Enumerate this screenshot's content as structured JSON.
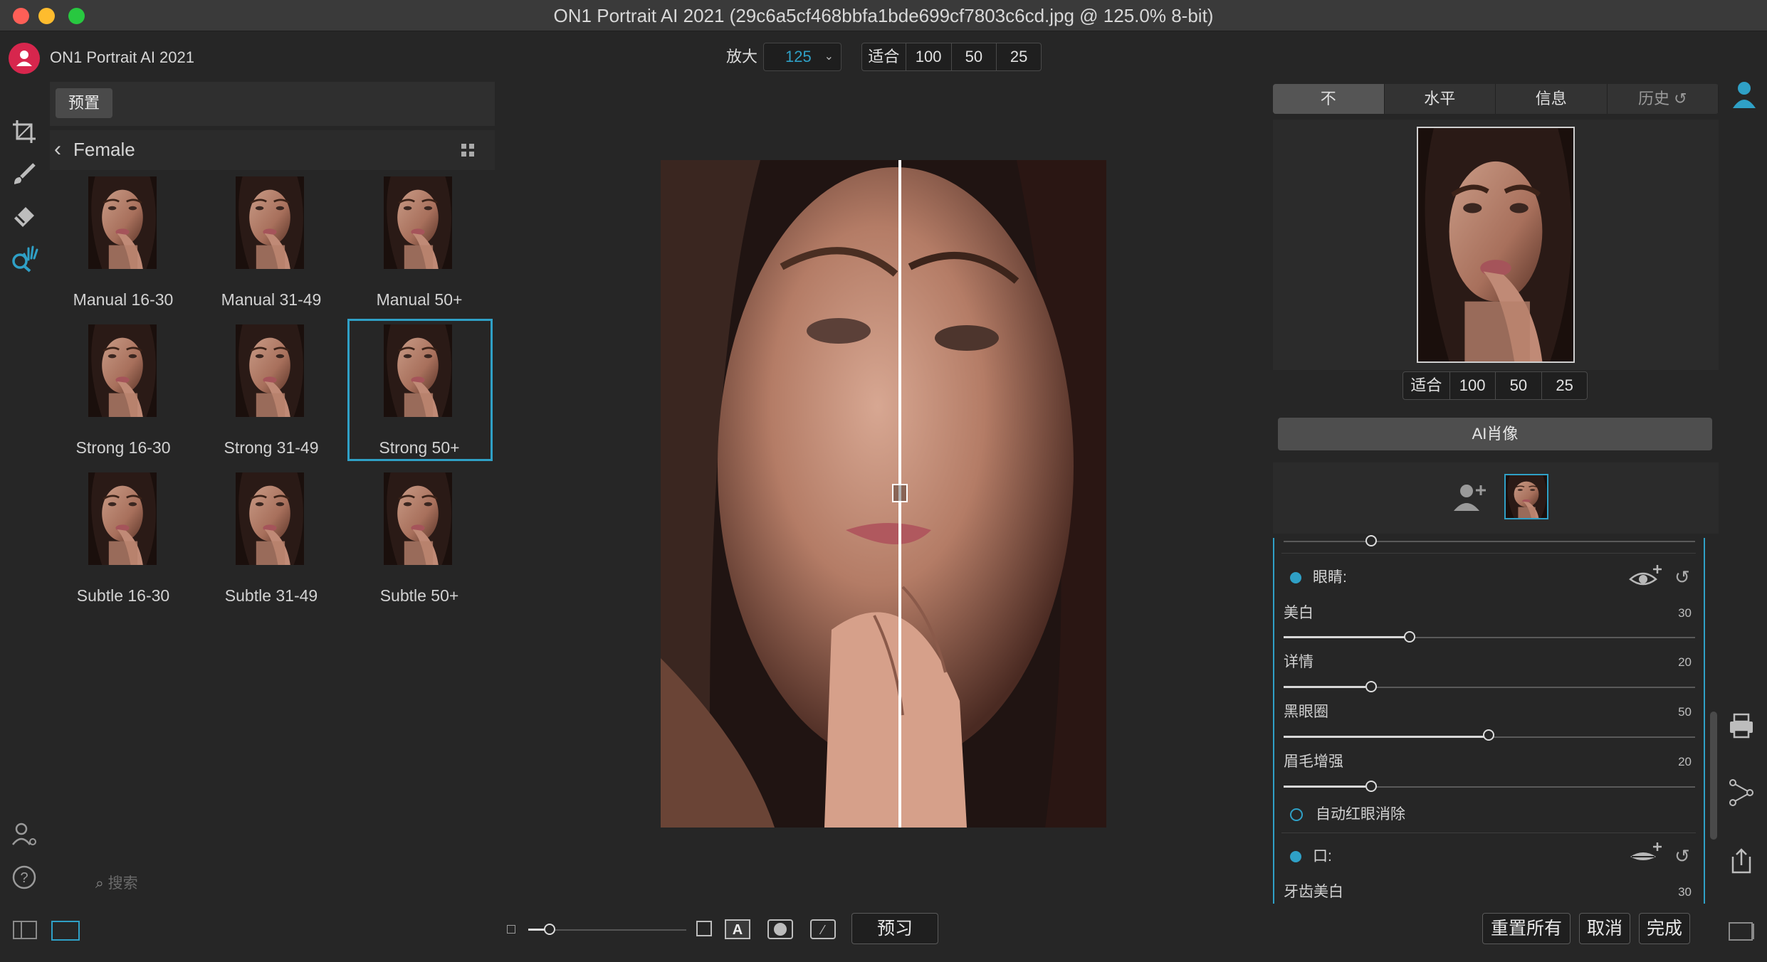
{
  "window": {
    "title": "ON1 Portrait AI 2021 (29c6a5cf468bbfa1bde699cf7803c6cd.jpg @ 125.0% 8-bit)"
  },
  "toolbar": {
    "app_name": "ON1 Portrait AI 2021",
    "zoom_label": "放大",
    "zoom_value": "125",
    "zoom_buttons": [
      "适合",
      "100",
      "50",
      "25"
    ]
  },
  "presets": {
    "tab_label": "预置",
    "category": "Female",
    "items": [
      "Manual 16-30",
      "Manual 31-49",
      "Manual 50+",
      "Strong 16-30",
      "Strong 31-49",
      "Strong 50+",
      "Subtle 16-30",
      "Subtle 31-49",
      "Subtle 50+"
    ],
    "selected": "Strong 50+",
    "search_placeholder": "搜索"
  },
  "right_panel": {
    "tabs": [
      "不",
      "水平",
      "信息",
      "历史"
    ],
    "nav_buttons": [
      "适合",
      "100",
      "50",
      "25"
    ],
    "ai_button": "AI肖像",
    "eyes_header": "眼睛:",
    "sliders": [
      {
        "label": "美白",
        "value": 30
      },
      {
        "label": "详情",
        "value": 20
      },
      {
        "label": "黑眼圈",
        "value": 50
      },
      {
        "label": "眉毛增强",
        "value": 20
      }
    ],
    "red_eye_label": "自动红眼消除",
    "mouth_header": "口:",
    "teeth_label": "牙齿美白",
    "teeth_value": 30
  },
  "bottom": {
    "preview_button": "预习",
    "reset_button": "重置所有",
    "cancel_button": "取消",
    "done_button": "完成"
  },
  "colors": {
    "accent": "#2fa0c6",
    "logo": "#d7264d",
    "close": "#fe5f57",
    "minimize": "#febc2e",
    "maximize": "#28c840"
  }
}
